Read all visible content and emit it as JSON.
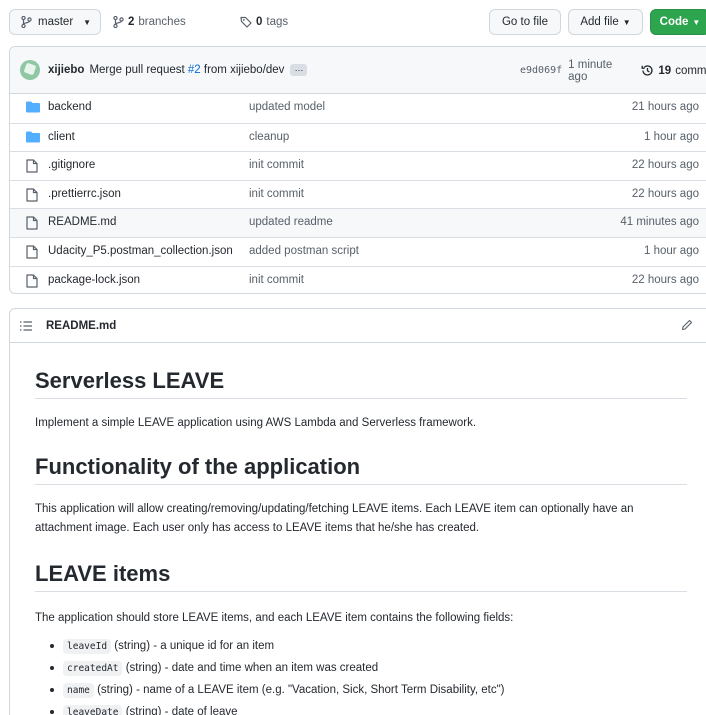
{
  "toolbar": {
    "branch": "master",
    "branches_count": "2",
    "branches_label": "branches",
    "tags_count": "0",
    "tags_label": "tags",
    "go_to_file": "Go to file",
    "add_file": "Add file",
    "code": "Code"
  },
  "commit": {
    "author": "xijiebo",
    "message_prefix": "Merge pull request",
    "pr_link": "#2",
    "message_suffix": "from xijiebo/dev",
    "ellipsis": "…",
    "sha": "e9d069f",
    "time": "1 minute ago",
    "commits_count": "19",
    "commits_label": "commits"
  },
  "files": [
    {
      "type": "folder",
      "name": "backend",
      "message": "updated model",
      "age": "21 hours ago"
    },
    {
      "type": "folder",
      "name": "client",
      "message": "cleanup",
      "age": "1 hour ago"
    },
    {
      "type": "file",
      "name": ".gitignore",
      "message": "init commit",
      "age": "22 hours ago"
    },
    {
      "type": "file",
      "name": ".prettierrc.json",
      "message": "init commit",
      "age": "22 hours ago"
    },
    {
      "type": "file",
      "name": "README.md",
      "message": "updated readme",
      "age": "41 minutes ago"
    },
    {
      "type": "file",
      "name": "Udacity_P5.postman_collection.json",
      "message": "added postman script",
      "age": "1 hour ago"
    },
    {
      "type": "file",
      "name": "package-lock.json",
      "message": "init commit",
      "age": "22 hours ago"
    }
  ],
  "readme": {
    "filename": "README.md",
    "h1_title": "Serverless LEAVE",
    "intro": "Implement a simple LEAVE application using AWS Lambda and Serverless framework.",
    "h2_functionality": "Functionality of the application",
    "functionality_text": "This application will allow creating/removing/updating/fetching LEAVE items. Each LEAVE item can optionally have an attachment image. Each user only has access to LEAVE items that he/she has created.",
    "h2_items": "LEAVE items",
    "items_text": "The application should store LEAVE items, and each LEAVE item contains the following fields:",
    "fields": [
      {
        "code": "leaveId",
        "desc": "(string) - a unique id for an item"
      },
      {
        "code": "createdAt",
        "desc": "(string) - date and time when an item was created"
      },
      {
        "code": "name",
        "desc": "(string) - name of a LEAVE item (e.g. \"Vacation, Sick, Short Term Disability, etc\")"
      },
      {
        "code": "leaveDate",
        "desc": "(string) - date of leave"
      }
    ]
  },
  "colors": {
    "code_button": "#2da44e",
    "link": "#0969da",
    "folder_icon": "#54aeff"
  }
}
